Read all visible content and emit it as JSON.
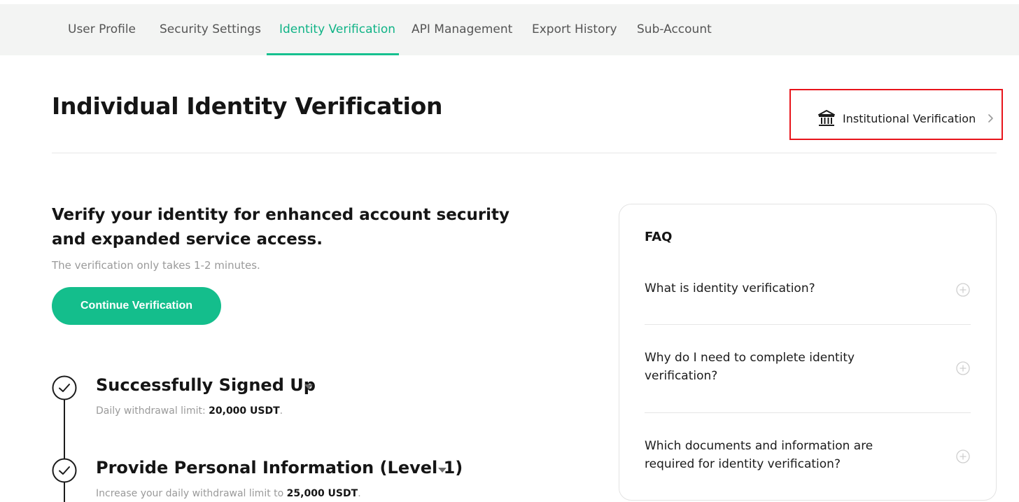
{
  "tabs": [
    {
      "label": "User Profile",
      "active": false
    },
    {
      "label": "Security Settings",
      "active": false
    },
    {
      "label": "Identity Verification",
      "active": true
    },
    {
      "label": "API Management",
      "active": false
    },
    {
      "label": "Export History",
      "active": false
    },
    {
      "label": "Sub-Account",
      "active": false
    }
  ],
  "header": {
    "title": "Individual Identity Verification",
    "institutional_link": "Institutional Verification",
    "institutional_icon": "bank-icon"
  },
  "intro": {
    "headline": "Verify your identity for enhanced account security and expanded service access.",
    "subtext": "The verification only takes 1-2 minutes.",
    "cta_label": "Continue Verification"
  },
  "steps": [
    {
      "title": "Successfully Signed Up",
      "desc_prefix": "Daily withdrawal limit: ",
      "desc_value": "20,000 USDT",
      "desc_suffix": ".",
      "completed": true
    },
    {
      "title": "Provide Personal Information (Level 1)",
      "desc_prefix": "Increase your daily withdrawal limit to ",
      "desc_value": "25,000 USDT",
      "desc_suffix": ".",
      "completed": true
    }
  ],
  "faq": {
    "title": "FAQ",
    "items": [
      {
        "question": "What is identity verification?"
      },
      {
        "question": "Why do I need to complete identity verification?"
      },
      {
        "question": "Which documents and information are required for identity verification?"
      }
    ]
  },
  "colors": {
    "accent": "#14be8c",
    "highlight_box": "#e8141b"
  }
}
